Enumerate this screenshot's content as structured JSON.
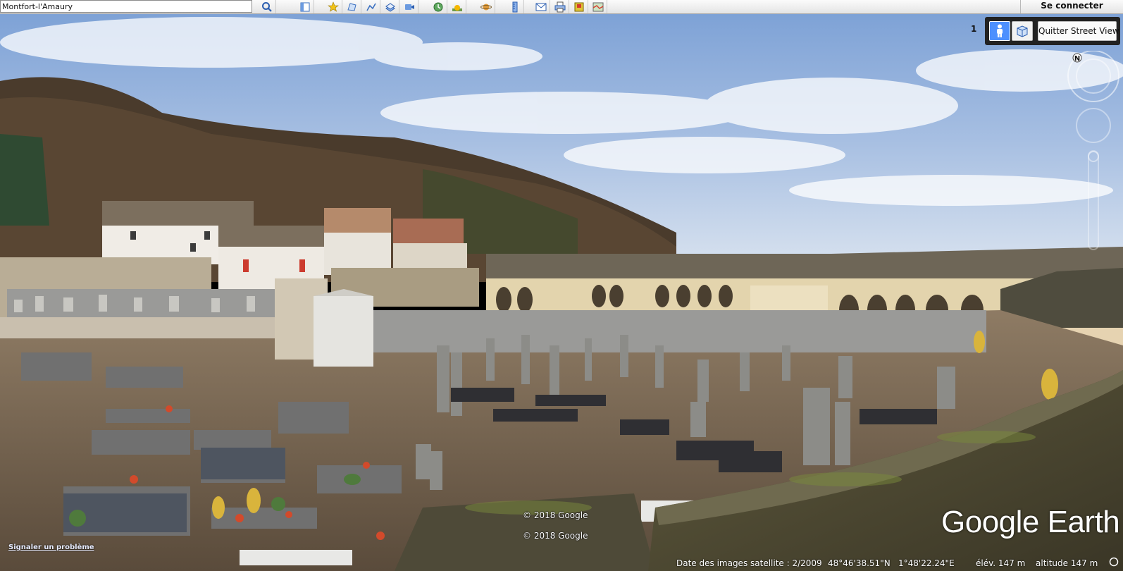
{
  "toolbar": {
    "search_value": "Montfort-l'Amaury",
    "buttons": [
      {
        "icon": "search-icon"
      },
      {
        "icon": "sidebar-icon"
      },
      {
        "icon": "placemark-icon"
      },
      {
        "icon": "polygon-icon"
      },
      {
        "icon": "path-icon"
      },
      {
        "icon": "image-overlay-icon"
      },
      {
        "icon": "record-tour-icon"
      },
      {
        "icon": "historical-imagery-icon"
      },
      {
        "icon": "sunlight-icon"
      },
      {
        "icon": "planets-icon"
      },
      {
        "icon": "ruler-icon"
      },
      {
        "icon": "email-icon"
      },
      {
        "icon": "print-icon"
      },
      {
        "icon": "save-image-icon"
      },
      {
        "icon": "view-in-maps-icon"
      }
    ],
    "signin_label": "Se connecter"
  },
  "streetview": {
    "count": "1",
    "exit_label": "Quitter Street View",
    "north_label": "N"
  },
  "overlays": {
    "copyright_1": "© 2018 Google",
    "copyright_2": "© 2018 Google",
    "report_label": "Signaler un problème",
    "logo": "Google Earth"
  },
  "status": {
    "imagery_date": "Date des images satellite : 2/2009",
    "latitude": "48°46'38.51\"N",
    "longitude": "1°48'22.24\"E",
    "elevation": "élév.  147 m",
    "altitude": "altitude   147 m"
  },
  "colors": {
    "sky_top": "#7ea2d6",
    "sky_bottom": "#d8e2ef",
    "street_view_blue": "#4d90fe"
  }
}
